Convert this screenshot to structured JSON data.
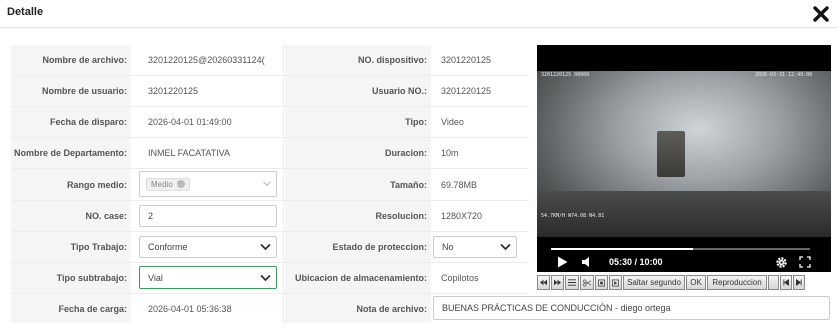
{
  "dialog": {
    "title": "Detalle"
  },
  "rows": [
    {
      "label1": "Nombre de archivo:",
      "value1": "3201220125@20260331124(",
      "label2": "NO. dispositivo:",
      "value2": "3201220125"
    },
    {
      "label1": "Nombre de usuario:",
      "value1": "3201220125",
      "label2": "Usuario NO.:",
      "value2": "3201220125"
    },
    {
      "label1": "Fecha de disparo:",
      "value1": "2026-04-01 01:49:00",
      "label2": "Tipo:",
      "value2": "Video"
    },
    {
      "label1": "Nombre de Departamento:",
      "value1": "INMEL FACATATIVA",
      "label2": "Duracion:",
      "value2": "10m"
    },
    {
      "label1": "Rango medio:",
      "value1": "Medio",
      "label2": "Tamaño:",
      "value2": "69.78MB"
    },
    {
      "label1": "NO. case:",
      "value1": "2",
      "label2": "Resolucion:",
      "value2": "1280X720"
    },
    {
      "label1": "Tipo Trabajo:",
      "value1": "Conforme",
      "label2": "Estado de proteccion:",
      "value2": "No"
    },
    {
      "label1": "Tipo subtrabajo:",
      "value1": "Vial",
      "label2": "Ubicacion de almacenamiento:",
      "value2": "Copilotos"
    },
    {
      "label1": "Fecha de carga:",
      "value1": "2026-04-01 05:36:38",
      "label2": "Nota de archivo:",
      "value2": "BUENAS PRÁCTICAS DE CONDUCCIÓN - diego ortega"
    }
  ],
  "video": {
    "time": "05:30 / 10:00",
    "progress_fraction": 0.55,
    "osd_top_left": "3201220125 00000",
    "osd_top_right": "2026-03-31 12:49:00",
    "osd_bottom_left": "54.7KM/H W74.08 N4.81"
  },
  "toolbar": {
    "seek_label": "Saltar segundo",
    "ok_label": "OK",
    "speed_label": "Reproduccion"
  },
  "icons": {
    "close": "close-x-icon",
    "play": "play-icon",
    "volume": "volume-icon",
    "settings": "gear-icon",
    "fullscreen": "fullscreen-icon"
  },
  "colors": {
    "label_bg": "#f5f5f5",
    "select_focus_border": "#3c9a5f",
    "video_bg": "#000000"
  }
}
